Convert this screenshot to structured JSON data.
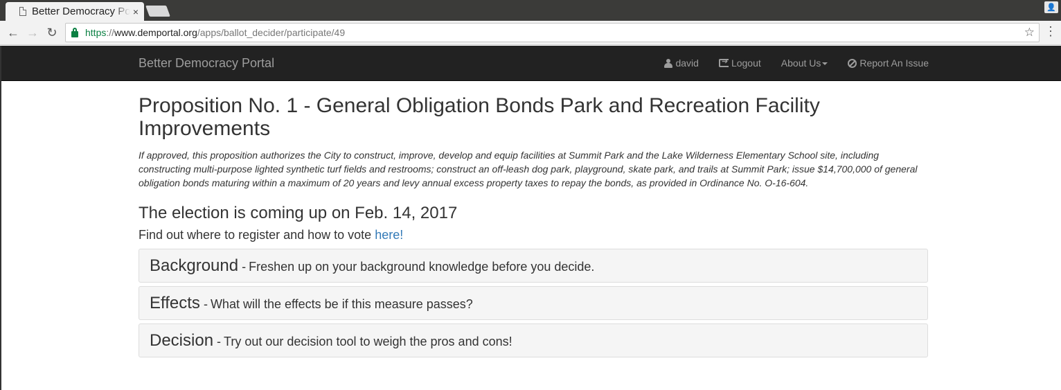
{
  "browser": {
    "tab_title": "Better Democracy Portal",
    "tab_close": "×",
    "url_scheme": "https",
    "url_sep": "://",
    "url_host": "www.demportal.org",
    "url_path": "/apps/ballot_decider/participate/49"
  },
  "navbar": {
    "brand": "Better Democracy Portal",
    "user": "david",
    "logout": "Logout",
    "about": "About Us",
    "report": "Report An Issue"
  },
  "page": {
    "title": "Proposition No. 1 - General Obligation Bonds Park and Recreation Facility Improvements",
    "description": "If approved, this proposition authorizes the City to construct, improve, develop and equip facilities at Summit Park and the Lake Wilderness Elementary School site, including constructing multi-purpose lighted synthetic turf fields and restrooms; construct an off-leash dog park, playground, skate park, and trails at Summit Park; issue $14,700,000 of general obligation bonds maturing within a maximum of 20 years and levy annual excess property taxes to repay the bonds, as provided in Ordinance No. O-16-604.",
    "election": "The election is coming up on Feb. 14, 2017",
    "register_text": "Find out where to register and how to vote ",
    "register_link": "here!",
    "panels": [
      {
        "heading": "Background",
        "sep": "-",
        "sub": "Freshen up on your background knowledge before you decide."
      },
      {
        "heading": "Effects",
        "sep": "-",
        "sub": "What will the effects be if this measure passes?"
      },
      {
        "heading": "Decision",
        "sep": "-",
        "sub": "Try out our decision tool to weigh the pros and cons!"
      }
    ]
  }
}
